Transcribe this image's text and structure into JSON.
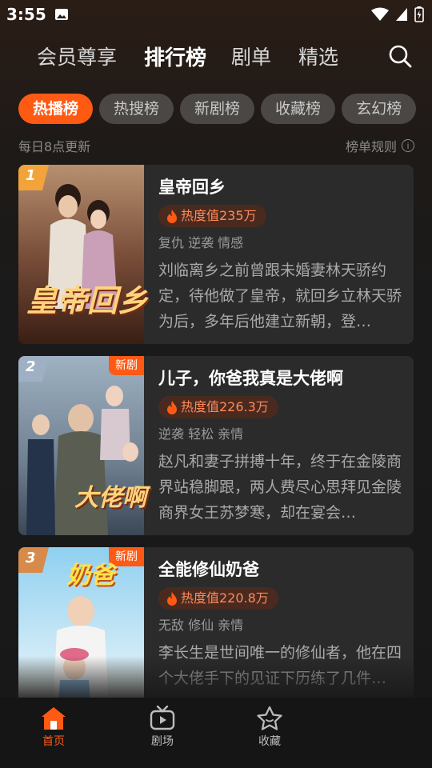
{
  "status_bar": {
    "time": "3:55"
  },
  "top_nav": {
    "tabs": [
      {
        "label": "会员尊享",
        "active": false
      },
      {
        "label": "排行榜",
        "active": true
      },
      {
        "label": "剧单",
        "active": false
      },
      {
        "label": "精选",
        "active": false
      }
    ],
    "search_icon": "search-icon"
  },
  "chips": [
    {
      "label": "热播榜",
      "active": true
    },
    {
      "label": "热搜榜",
      "active": false
    },
    {
      "label": "新剧榜",
      "active": false
    },
    {
      "label": "收藏榜",
      "active": false
    },
    {
      "label": "玄幻榜",
      "active": false
    }
  ],
  "subline": {
    "update_text": "每日8点更新",
    "rules_label": "榜单规则"
  },
  "list": [
    {
      "rank": "1",
      "title": "皇帝回乡",
      "heat": "热度值235万",
      "tags": "复仇 逆袭 情感",
      "description": "刘临离乡之前曾跟未婚妻林天骄约定，待他做了皇帝，就回乡立林天骄为后，多年后他建立新朝，登…",
      "poster_text": "皇帝回乡",
      "new": false
    },
    {
      "rank": "2",
      "title": "儿子，你爸我真是大佬啊",
      "heat": "热度值226.3万",
      "tags": "逆袭 轻松 亲情",
      "description": "赵凡和妻子拼搏十年，终于在金陵商界站稳脚跟，两人费尽心思拜见金陵商界女王苏梦寒，却在宴会…",
      "poster_text": "大佬啊",
      "new": true,
      "new_label": "新剧"
    },
    {
      "rank": "3",
      "title": "全能修仙奶爸",
      "heat": "热度值220.8万",
      "tags": "无敌 修仙 亲情",
      "description": "李长生是世间唯一的修仙者，他在四个大佬手下的见证下历练了几件…",
      "poster_text": "奶爸",
      "new": true,
      "new_label": "新剧"
    }
  ],
  "bottom_nav": [
    {
      "label": "首页",
      "icon": "home-icon",
      "active": true
    },
    {
      "label": "剧场",
      "icon": "tv-play-icon",
      "active": false
    },
    {
      "label": "收藏",
      "icon": "star-icon",
      "active": false
    }
  ],
  "colors": {
    "accent": "#ff5a14",
    "heat_text": "#ff8a5a",
    "card_bg": "#2b2b2b"
  }
}
